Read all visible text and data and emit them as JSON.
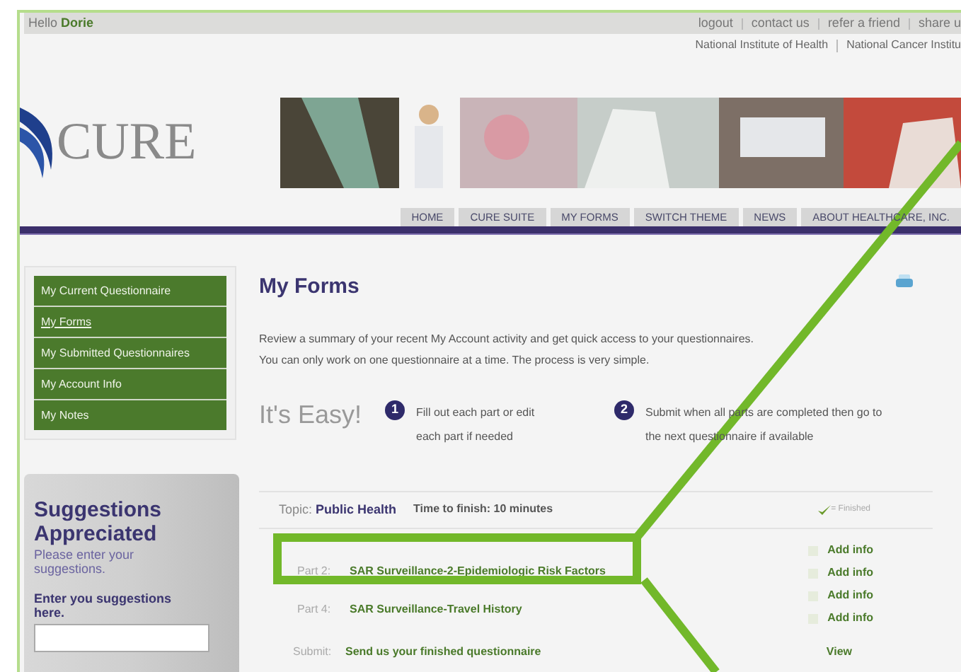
{
  "greeting": {
    "prefix": "Hello",
    "name": "Dorie"
  },
  "top_links": [
    "logout",
    "contact us",
    "refer a friend",
    "share u"
  ],
  "partner_links": [
    "National Institute of Health",
    "National Cancer Institu"
  ],
  "logo": "CURE",
  "header_picture": {
    "kind": "picture"
  },
  "nav": [
    "HOME",
    "CURE SUITE",
    "MY FORMS",
    "SWITCH THEME",
    "NEWS",
    "ABOUT HEALTHCARE, INC."
  ],
  "sidebar": {
    "items": [
      {
        "label": "My Current Questionnaire",
        "selected": false
      },
      {
        "label": "My Forms",
        "selected": true
      },
      {
        "label": "My Submitted Questionnaires",
        "selected": false
      },
      {
        "label": "My Account Info",
        "selected": false
      },
      {
        "label": "My Notes",
        "selected": false
      }
    ]
  },
  "suggestions": {
    "title": "Suggestions Appreciated",
    "hint": "Please enter your suggestions.",
    "field_label": "Enter you suggestions here."
  },
  "main": {
    "title": "My Forms",
    "intro": [
      "Review a summary of your recent My Account activity and get quick access to your questionnaires.",
      "You can only work on one questionnaire at a time. The process is very simple."
    ],
    "easy_title": "It's Easy!",
    "steps": [
      {
        "number": "1",
        "text": "Fill out each part or edit each part if needed"
      },
      {
        "number": "2",
        "text": "Submit when all parts are completed then go to the next questionnaire if available"
      }
    ],
    "topic": {
      "label": "Topic:",
      "value": "Public Health",
      "time": "Time to finish: 10 minutes"
    },
    "legend": "= Finished",
    "parts": [
      {
        "label": "Part 2:",
        "title": "SAR Surveillance-2-Epidemiologic Risk Factors"
      },
      {
        "label": "Part 4:",
        "title": "SAR Surveillance-Travel History"
      }
    ],
    "actions": [
      {
        "label": "Add info",
        "checked": false
      },
      {
        "label": "Add info",
        "checked": false
      },
      {
        "label": "Add info",
        "checked": false
      },
      {
        "label": "Add info",
        "checked": false
      }
    ],
    "submit": {
      "label": "Submit:",
      "title": "Send us your finished questionnaire",
      "action": "View"
    }
  }
}
